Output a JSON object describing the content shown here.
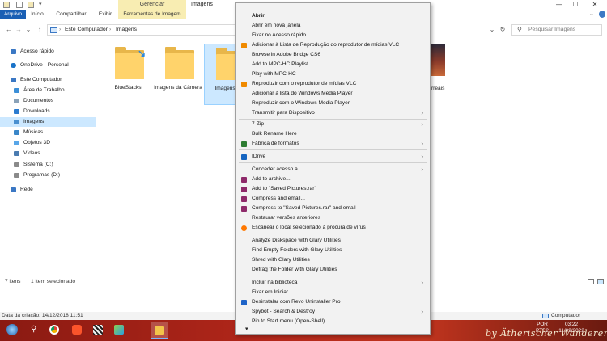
{
  "window": {
    "title": "Imagens",
    "context_tab_group": "Gerenciar",
    "controls": {
      "minimize": "—",
      "maximize": "☐",
      "close": "✕"
    }
  },
  "ribbon": {
    "tabs": [
      "Arquivo",
      "Início",
      "Compartilhar",
      "Exibir",
      "Ferramentas de Imagem"
    ]
  },
  "address": {
    "crumbs": [
      "Este Computador",
      "Imagens"
    ],
    "separator": "›",
    "search_placeholder": "Pesquisar Imagens",
    "nav": {
      "back": "←",
      "forward": "→",
      "down": "⌄",
      "up": "↑",
      "refresh": "↻",
      "dropdown": "⌄"
    }
  },
  "nav_pane": {
    "items": [
      {
        "label": "Acesso rápido",
        "icon": "star-icon",
        "color": "#3b78c4"
      },
      {
        "label": "OneDrive - Personal",
        "icon": "cloud-icon",
        "color": "#1a73c8"
      },
      {
        "label": "Este Computador",
        "icon": "computer-icon",
        "color": "#3b78c4"
      },
      {
        "label": "Área de Trabalho",
        "icon": "desktop-icon",
        "color": "#3b8fd8"
      },
      {
        "label": "Documentos",
        "icon": "documents-icon",
        "color": "#8aa2b8"
      },
      {
        "label": "Downloads",
        "icon": "download-icon",
        "color": "#2a7bd0"
      },
      {
        "label": "Imagens",
        "icon": "pictures-icon",
        "color": "#4a90d0"
      },
      {
        "label": "Músicas",
        "icon": "music-icon",
        "color": "#3a86c8"
      },
      {
        "label": "Objetos 3D",
        "icon": "objects-3d-icon",
        "color": "#58a6e8"
      },
      {
        "label": "Vídeos",
        "icon": "videos-icon",
        "color": "#4a7bb0"
      },
      {
        "label": "Sistema (C:)",
        "icon": "drive-icon",
        "color": "#8a8a8a"
      },
      {
        "label": "Programas (D:)",
        "icon": "drive-icon",
        "color": "#8a8a8a"
      },
      {
        "label": "Rede",
        "icon": "network-icon",
        "color": "#3b78c4"
      }
    ],
    "selected": "Imagens"
  },
  "files": [
    {
      "label": "BlueStacks",
      "overlay": "bluestacks-arrow-icon"
    },
    {
      "label": "Imagens da Câmera",
      "overlay": ""
    },
    {
      "label": "Imagens Sa",
      "overlay": "",
      "selected": true
    }
  ],
  "partial_file_label": "surreais",
  "status": {
    "item_count": "7 itens",
    "selection": "1 item selecionado",
    "details": "Data da criação: 14/12/2018 11:51",
    "location": "Computador"
  },
  "taskbar": {
    "apps": [
      "start-icon",
      "search-icon",
      "chrome-icon",
      "brave-icon",
      "clapperboard-icon",
      "bluestacks-icon",
      "file-explorer-icon"
    ],
    "lang": "POR",
    "lang2": "PTB2",
    "time": "03:22",
    "date": "11/09/2022",
    "watermark": "by Ätherischer Wanderer"
  },
  "context_menu": {
    "items": [
      {
        "label": "Abrir",
        "bold": true
      },
      {
        "label": "Abrir em nova janela"
      },
      {
        "label": "Fixar no Acesso rápido"
      },
      {
        "label": "Adicionar à Lista de Reprodução do reprodutor de mídias VLC",
        "icon": "vlc-icon",
        "color": "#f08a00"
      },
      {
        "label": "Browse in Adobe Bridge CS6"
      },
      {
        "label": "Add to MPC-HC Playlist"
      },
      {
        "label": "Play with MPC-HC"
      },
      {
        "label": "Reproduzir com o reprodutor de mídias VLC",
        "icon": "vlc-icon",
        "color": "#f08a00"
      },
      {
        "label": "Adicionar à lista do Windows Media Player"
      },
      {
        "label": "Reproduzir com o Windows Media Player"
      },
      {
        "label": "Transmitir para Dispositivo",
        "submenu": true
      },
      {
        "label": "7-Zip",
        "submenu": true
      },
      {
        "label": "Bulk Rename Here"
      },
      {
        "label": "Fábrica de formatos",
        "icon": "format-factory-icon",
        "color": "#2e7d32",
        "submenu": true
      },
      {
        "label": "IDrive",
        "icon": "idrive-icon",
        "color": "#1565c0",
        "submenu": true
      },
      {
        "label": "Conceder acesso a",
        "submenu": true
      },
      {
        "label": "Add to archive...",
        "icon": "winrar-icon",
        "color": "#8e2a6a"
      },
      {
        "label": "Add to \"Saved Pictures.rar\"",
        "icon": "winrar-icon",
        "color": "#8e2a6a"
      },
      {
        "label": "Compress and email...",
        "icon": "winrar-icon",
        "color": "#8e2a6a"
      },
      {
        "label": "Compress to \"Saved Pictures.rar\" and email",
        "icon": "winrar-icon",
        "color": "#8e2a6a"
      },
      {
        "label": "Restaurar versões anteriores"
      },
      {
        "label": "Escanear o local selecionado à procura de vírus",
        "icon": "avast-icon",
        "color": "#ff7800"
      },
      {
        "label": "Analyze Diskspace with Glary Utilities"
      },
      {
        "label": "Find Empty Folders with Glary Utilities"
      },
      {
        "label": "Shred with Glary Utilities"
      },
      {
        "label": "Defrag the Folder with Glary Utilities"
      },
      {
        "label": "Incluir na biblioteca",
        "submenu": true
      },
      {
        "label": "Fixar em Iniciar"
      },
      {
        "label": "Desinstalar com Revo Uninstaller Pro",
        "icon": "revo-icon",
        "color": "#1e64c8"
      },
      {
        "label": "Spybot - Search & Destroy",
        "submenu": true
      },
      {
        "label": "Pin to Start menu (Open-Shell)"
      }
    ],
    "more_arrow": "▾",
    "submenu_arrow": "›"
  }
}
